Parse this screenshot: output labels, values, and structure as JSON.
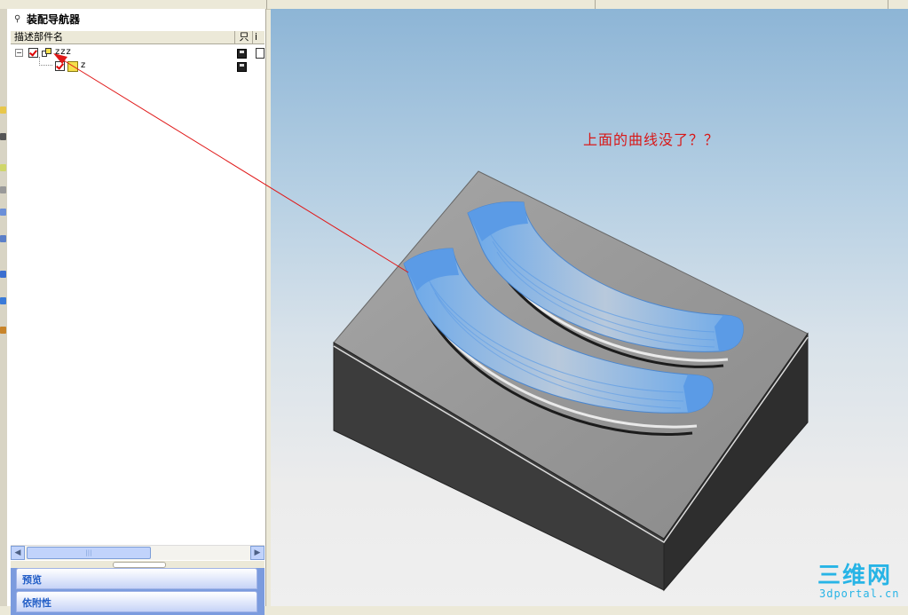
{
  "navigator": {
    "title": "装配导航器",
    "columns": {
      "name": "描述部件名",
      "readonly": "只",
      "info": "i"
    },
    "tree": [
      {
        "label": "zzz",
        "level": 0,
        "checked": true,
        "type": "assembly",
        "expanded": true
      },
      {
        "label": "z",
        "level": 1,
        "checked": true,
        "type": "part"
      }
    ],
    "sections": {
      "preview": "预览",
      "dependency": "依附性"
    }
  },
  "viewport": {
    "annotation": "上面的曲线没了？？",
    "annotation_color": "#d81818"
  },
  "watermark": {
    "logo": "三维网",
    "site": "3dportal.cn",
    "color": "#27b4e6"
  },
  "colors": {
    "surface_blue": "#5b9be6",
    "block_top": "#9c9c9c",
    "block_side_dark": "#3c3c3c"
  }
}
